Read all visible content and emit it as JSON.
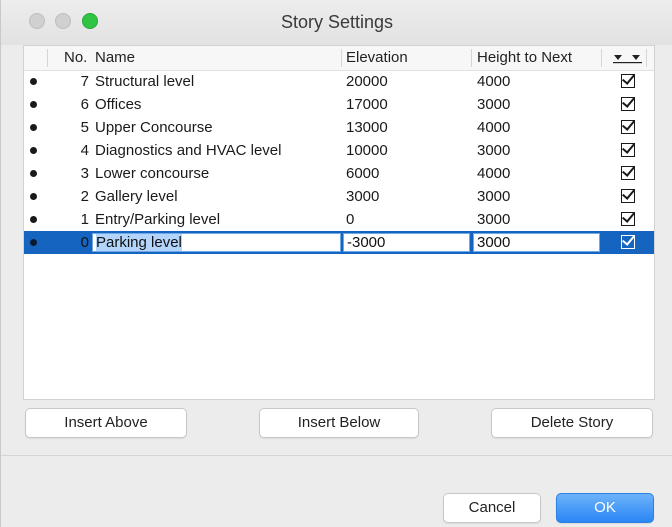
{
  "window": {
    "title": "Story Settings"
  },
  "columns": {
    "no": "No.",
    "name": "Name",
    "elevation": "Elevation",
    "height": "Height to Next"
  },
  "rows": [
    {
      "no": "7",
      "name": "Structural level",
      "elevation": "20000",
      "height": "4000",
      "checked": true
    },
    {
      "no": "6",
      "name": "Offices",
      "elevation": "17000",
      "height": "3000",
      "checked": true
    },
    {
      "no": "5",
      "name": "Upper Concourse",
      "elevation": "13000",
      "height": "4000",
      "checked": true
    },
    {
      "no": "4",
      "name": "Diagnostics and HVAC level",
      "elevation": "10000",
      "height": "3000",
      "checked": true
    },
    {
      "no": "3",
      "name": "Lower concourse",
      "elevation": "6000",
      "height": "4000",
      "checked": true
    },
    {
      "no": "2",
      "name": "Gallery level",
      "elevation": "3000",
      "height": "3000",
      "checked": true
    },
    {
      "no": "1",
      "name": "Entry/Parking level",
      "elevation": "0",
      "height": "3000",
      "checked": true
    },
    {
      "no": "0",
      "name": "Parking level",
      "elevation": "-3000",
      "height": "3000",
      "checked": true,
      "selected": true
    }
  ],
  "buttons": {
    "insert_above": "Insert Above",
    "insert_below": "Insert Below",
    "delete_story": "Delete Story",
    "cancel": "Cancel",
    "ok": "OK"
  },
  "icons": {
    "column_menu": "double-down-triangle-icon",
    "row_marker": "bullet-icon",
    "checkbox": "checkmark-icon"
  },
  "colors": {
    "selection": "#1565c0",
    "accent": "#2a86f5"
  }
}
